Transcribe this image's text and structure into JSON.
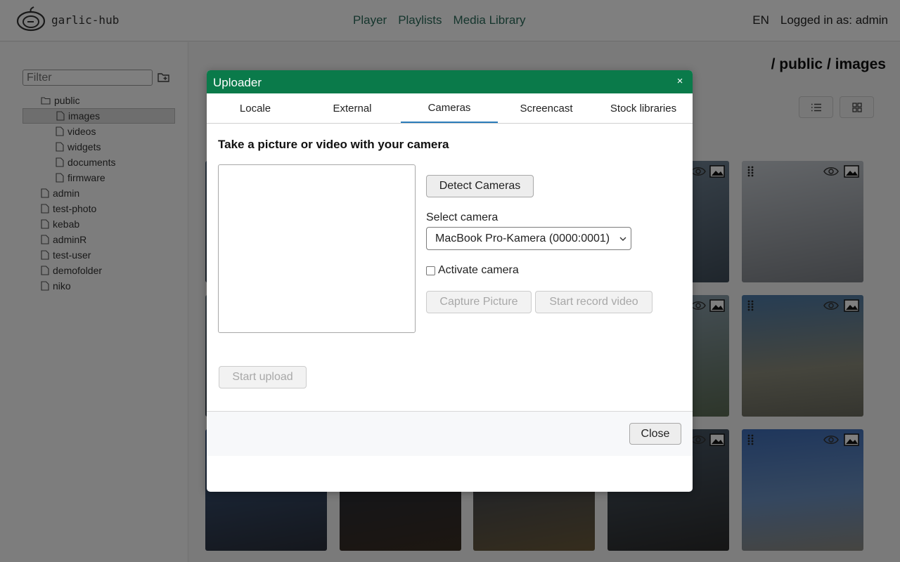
{
  "app": {
    "logo_text": "garlic-hub",
    "nav": [
      "Player",
      "Playlists",
      "Media Library"
    ],
    "language": "EN",
    "logged_in": "Logged in as: admin"
  },
  "sidebar": {
    "filter_placeholder": "Filter",
    "tree": [
      {
        "label": "public",
        "type": "folder",
        "level": 0
      },
      {
        "label": "images",
        "type": "file",
        "level": 1,
        "selected": true
      },
      {
        "label": "videos",
        "type": "file",
        "level": 1
      },
      {
        "label": "widgets",
        "type": "file",
        "level": 1
      },
      {
        "label": "documents",
        "type": "file",
        "level": 1
      },
      {
        "label": "firmware",
        "type": "file",
        "level": 1
      },
      {
        "label": "admin",
        "type": "file",
        "level": 0
      },
      {
        "label": "test-photo",
        "type": "file",
        "level": 0
      },
      {
        "label": "kebab",
        "type": "file",
        "level": 0
      },
      {
        "label": "adminR",
        "type": "file",
        "level": 0
      },
      {
        "label": "test-user",
        "type": "file",
        "level": 0
      },
      {
        "label": "demofolder",
        "type": "file",
        "level": 0
      },
      {
        "label": "niko",
        "type": "file",
        "level": 0
      }
    ]
  },
  "main": {
    "path_title": "/ public / images"
  },
  "modal": {
    "title": "Uploader",
    "close_symbol": "×",
    "tabs": [
      "Locale",
      "External",
      "Cameras",
      "Screencast",
      "Stock libraries"
    ],
    "active_tab": "Cameras",
    "heading": "Take a picture or video with your camera",
    "detect_cameras": "Detect Cameras",
    "select_camera_label": "Select camera",
    "selected_camera": "MacBook Pro-Kamera (0000:0001)",
    "activate_camera": "Activate camera",
    "capture_picture": "Capture Picture",
    "start_record_video": "Start record video",
    "start_upload": "Start upload",
    "close_button": "Close"
  },
  "colors": {
    "modal_header": "#0a7a4a",
    "nav_link": "#2a6b5a",
    "active_tab_underline": "#2b7cba"
  }
}
